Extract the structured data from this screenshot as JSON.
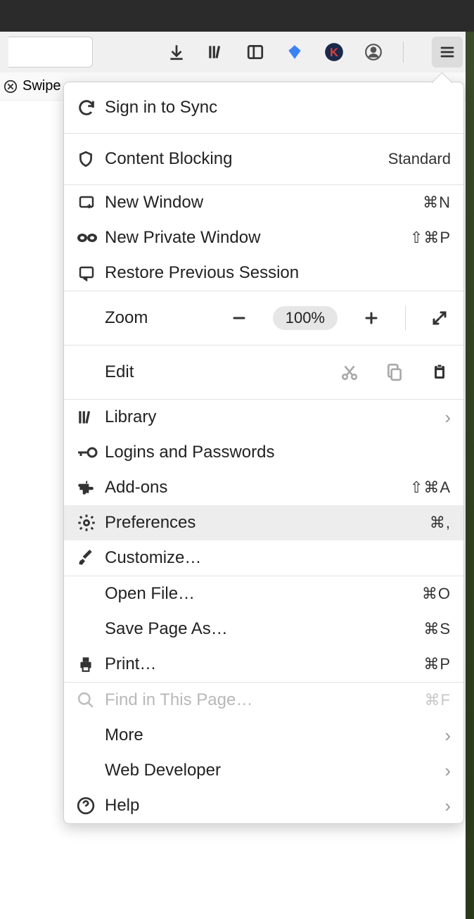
{
  "below_toolbar_text": "Swipe",
  "menu": {
    "sign_in": "Sign in to Sync",
    "content_blocking": {
      "label": "Content Blocking",
      "status": "Standard"
    },
    "new_window": {
      "label": "New Window",
      "shortcut": "⌘N"
    },
    "new_private": {
      "label": "New Private Window",
      "shortcut": "⇧⌘P"
    },
    "restore": "Restore Previous Session",
    "zoom": {
      "label": "Zoom",
      "level": "100%"
    },
    "edit": {
      "label": "Edit"
    },
    "library": "Library",
    "logins": "Logins and Passwords",
    "addons": {
      "label": "Add-ons",
      "shortcut": "⇧⌘A"
    },
    "preferences": {
      "label": "Preferences",
      "shortcut": "⌘,"
    },
    "customize": "Customize…",
    "open_file": {
      "label": "Open File…",
      "shortcut": "⌘O"
    },
    "save_as": {
      "label": "Save Page As…",
      "shortcut": "⌘S"
    },
    "print": {
      "label": "Print…",
      "shortcut": "⌘P"
    },
    "find": {
      "label": "Find in This Page…",
      "shortcut": "⌘F"
    },
    "more": "More",
    "web_dev": "Web Developer",
    "help": "Help"
  }
}
